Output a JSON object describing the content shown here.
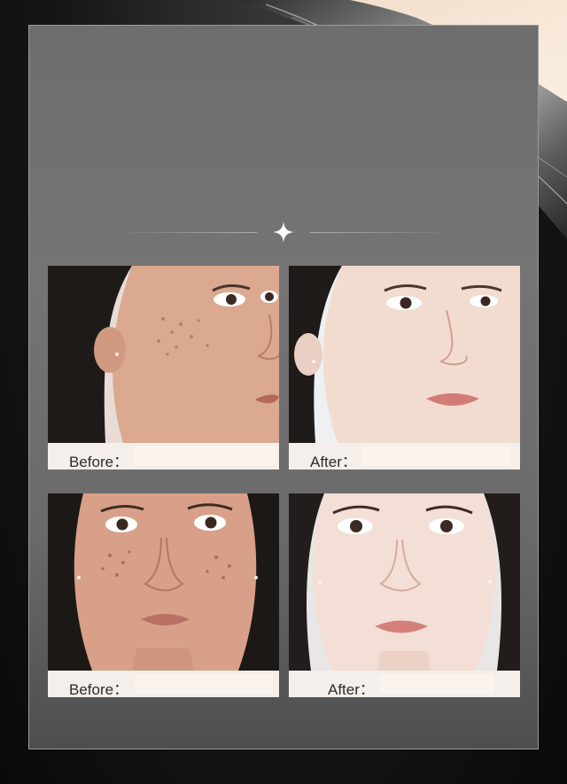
{
  "comparisons": [
    {
      "id": "p1",
      "label": "Before："
    },
    {
      "id": "p2",
      "label": "After："
    },
    {
      "id": "p3",
      "label": "Before："
    },
    {
      "id": "p4",
      "label": "After："
    }
  ],
  "icons": {
    "divider_center": "four-point-star-icon"
  },
  "colors": {
    "panel": "#747474",
    "caption_bar": "#f4efeb",
    "background": "#0f0f0f"
  }
}
